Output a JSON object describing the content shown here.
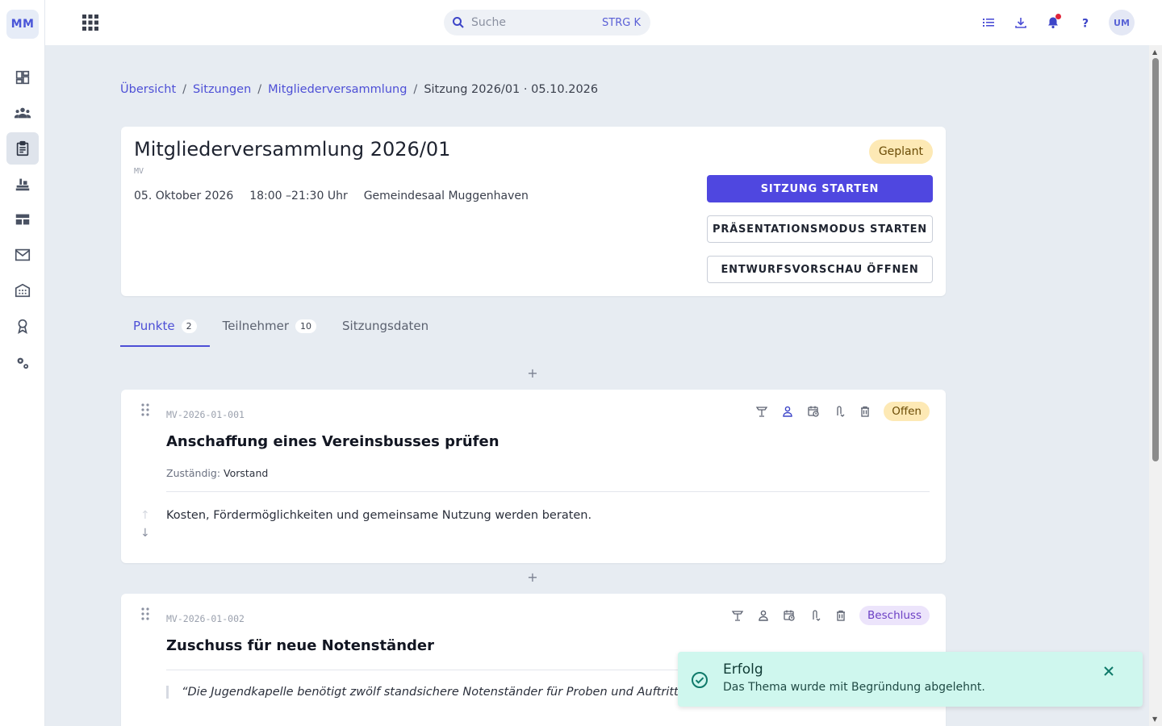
{
  "rail": {
    "logo": "MM",
    "items": [
      {
        "icon": "dashboard-icon",
        "active": false
      },
      {
        "icon": "members-icon",
        "active": false
      },
      {
        "icon": "clipboard-icon",
        "active": true
      },
      {
        "icon": "instrument-icon",
        "active": false
      },
      {
        "icon": "table-icon",
        "active": false
      },
      {
        "icon": "mail-icon",
        "active": false
      },
      {
        "icon": "building-icon",
        "active": false
      },
      {
        "icon": "award-icon",
        "active": false
      },
      {
        "icon": "settings-icon",
        "active": false
      }
    ]
  },
  "topbar": {
    "search_placeholder": "Suche",
    "search_shortcut": "STRG K",
    "avatar": "UM",
    "notification_dot_color": "#e0243a"
  },
  "breadcrumb": {
    "items": [
      "Übersicht",
      "Sitzungen",
      "Mitgliederversammlung"
    ],
    "separator": "/",
    "current": "Sitzung 2026/01 · 05.10.2026"
  },
  "meeting": {
    "title": "Mitgliederversammlung 2026/01",
    "abbr": "MV",
    "date": "05. Oktober 2026",
    "time": "18:00 –21:30 Uhr",
    "location": "Gemeindesaal Muggenhaven",
    "status": "Geplant",
    "buttons": {
      "start": "SITZUNG STARTEN",
      "presentation": "PRÄSENTATIONSMODUS STARTEN",
      "draft_preview": "ENTWURFSVORSCHAU ÖFFNEN"
    }
  },
  "tabs": [
    {
      "label": "Punkte",
      "count": "2",
      "active": true
    },
    {
      "label": "Teilnehmer",
      "count": "10",
      "active": false
    },
    {
      "label": "Sitzungsdaten",
      "count": "",
      "active": false
    }
  ],
  "add_symbol": "+",
  "items": [
    {
      "ident": "MV-2026-01-001",
      "title": "Anschaffung eines Vereinsbusses prüfen",
      "responsible_label": "Zuständig:",
      "responsible_value": "Vorstand",
      "description": "Kosten, Fördermöglichkeiten und gemeinsame Nutzung werden beraten.",
      "status": "Offen",
      "up_arrow": "↑",
      "down_arrow": "↓"
    },
    {
      "ident": "MV-2026-01-002",
      "title": "Zuschuss für neue Notenständer",
      "quote": "“Die Jugendkapelle benötigt zwölf standsichere Notenständer für Proben und Auftritte.",
      "status": "Beschluss"
    }
  ],
  "toast": {
    "title": "Erfolg",
    "message": "Das Thema wurde mit Begründung abgelehnt."
  },
  "colors": {
    "accent": "#4f47e0",
    "link": "#4d4fd6",
    "toast_bg": "#cff7ee",
    "status_planned_bg": "#fde9b5",
    "status_decision_bg": "#ece4fb"
  }
}
